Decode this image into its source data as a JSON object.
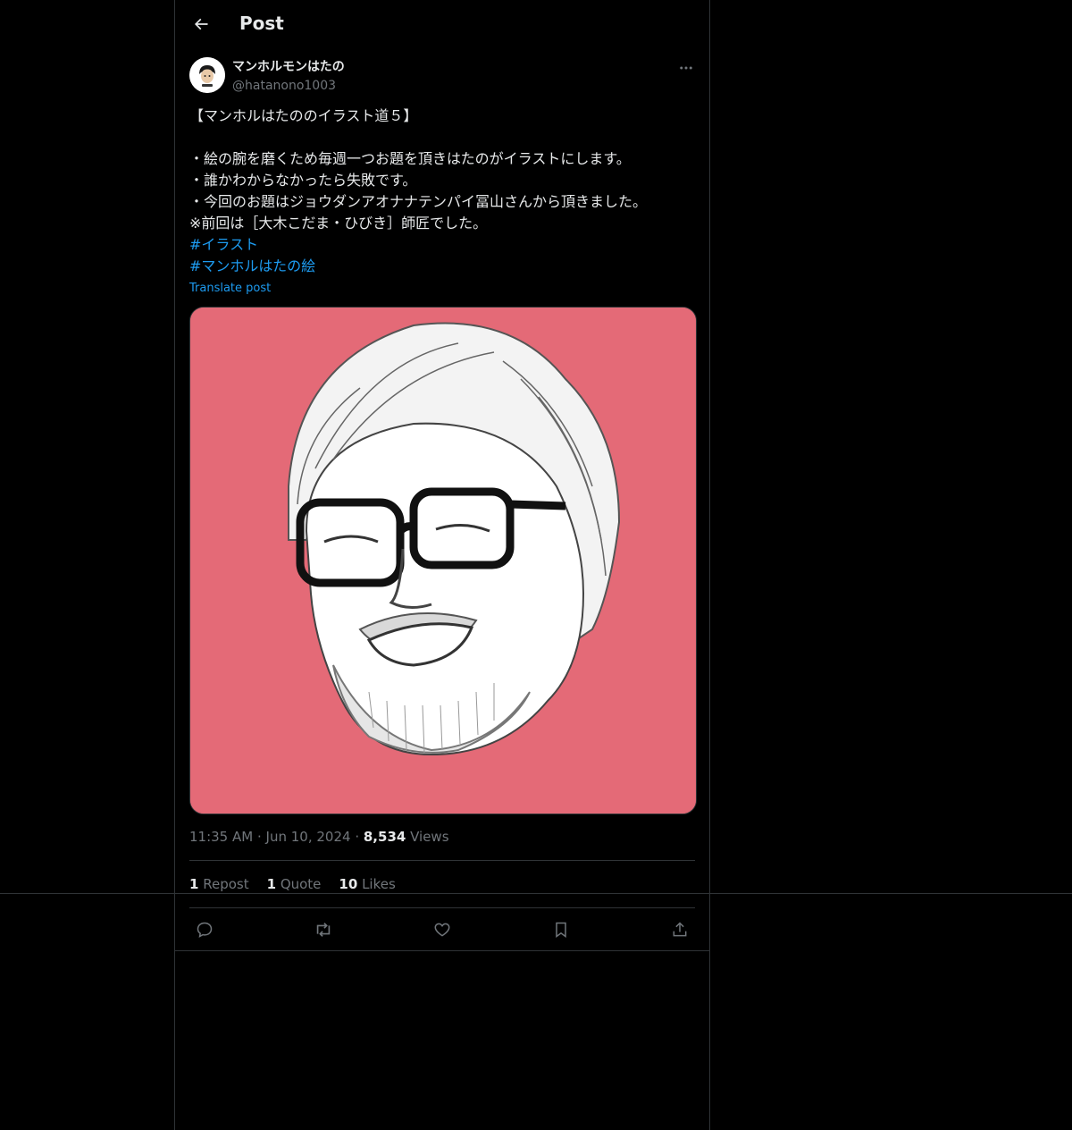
{
  "header": {
    "title": "Post",
    "back_icon": "arrow-left-icon"
  },
  "author": {
    "display_name": "マンホルモンはたの",
    "handle": "@hatanono1003",
    "avatar_icon": "avatar"
  },
  "post": {
    "lines": [
      "【マンホルはたののイラスト道５】",
      "",
      "・絵の腕を磨くため毎週一つお題を頂きはたのがイラストにします。",
      "・誰かわからなかったら失敗です。",
      "・今回のお題はジョウダンアオナナテンパイ冨山さんから頂きました。",
      "※前回は［大木こだま・ひびき］師匠でした。"
    ],
    "hashtags": [
      "#イラスト",
      "#マンホルはたの絵"
    ],
    "translate_label": "Translate post",
    "time": "11:35 AM",
    "date": "Jun 10, 2024",
    "views_count": "8,534",
    "views_label": "Views",
    "image_bg": "#e46a77"
  },
  "stats": {
    "reposts_count": "1",
    "reposts_label": "Repost",
    "quotes_count": "1",
    "quotes_label": "Quote",
    "likes_count": "10",
    "likes_label": "Likes"
  },
  "actions": [
    "reply-icon",
    "repost-icon",
    "like-icon",
    "bookmark-icon",
    "share-icon"
  ],
  "colors": {
    "background": "#000000",
    "text": "#e7e9ea",
    "secondary": "#71767b",
    "link": "#1d9bf0",
    "border": "#2f3336"
  }
}
